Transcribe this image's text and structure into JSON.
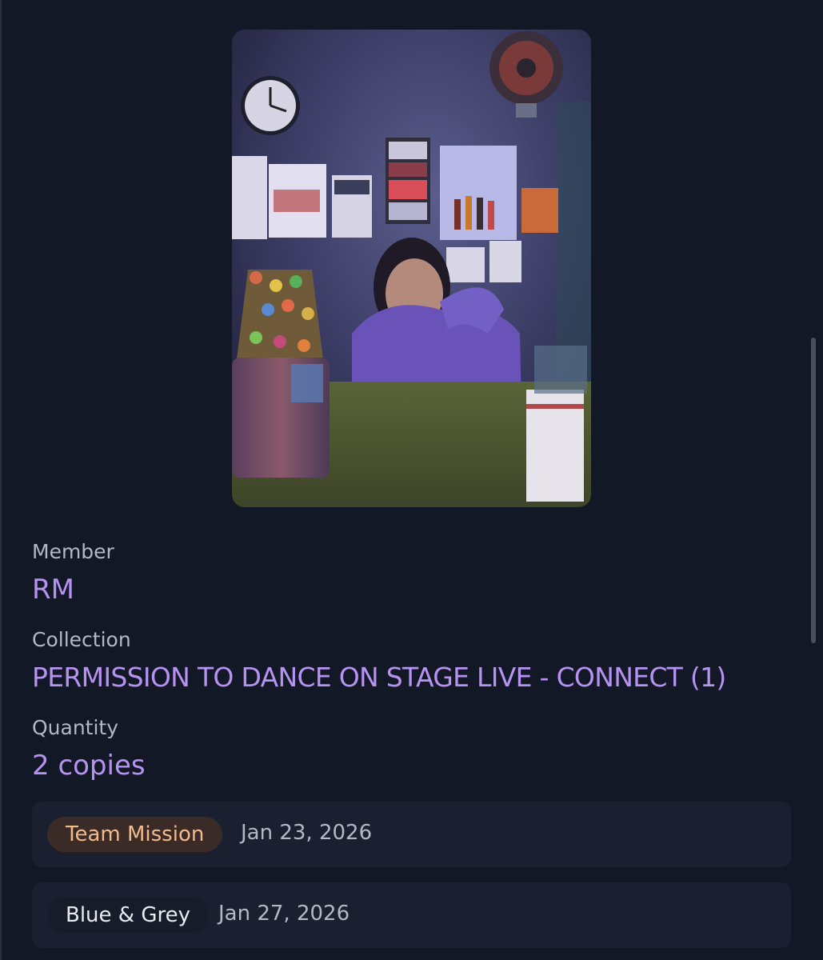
{
  "card": {
    "photo_alt": "RM photocard"
  },
  "details": {
    "member_label": "Member",
    "member_value": "RM",
    "collection_label": "Collection",
    "collection_value": "PERMISSION TO DANCE ON STAGE LIVE - CONNECT (1)",
    "quantity_label": "Quantity",
    "quantity_value": "2 copies"
  },
  "records": [
    {
      "tag": "Team Mission",
      "date": "Jan 23, 2026"
    },
    {
      "tag": "Blue & Grey",
      "date": "Jan 27, 2026"
    }
  ],
  "colors": {
    "background": "#121826",
    "accent": "#b793f1",
    "mission_chip_text": "#f2b98d"
  }
}
